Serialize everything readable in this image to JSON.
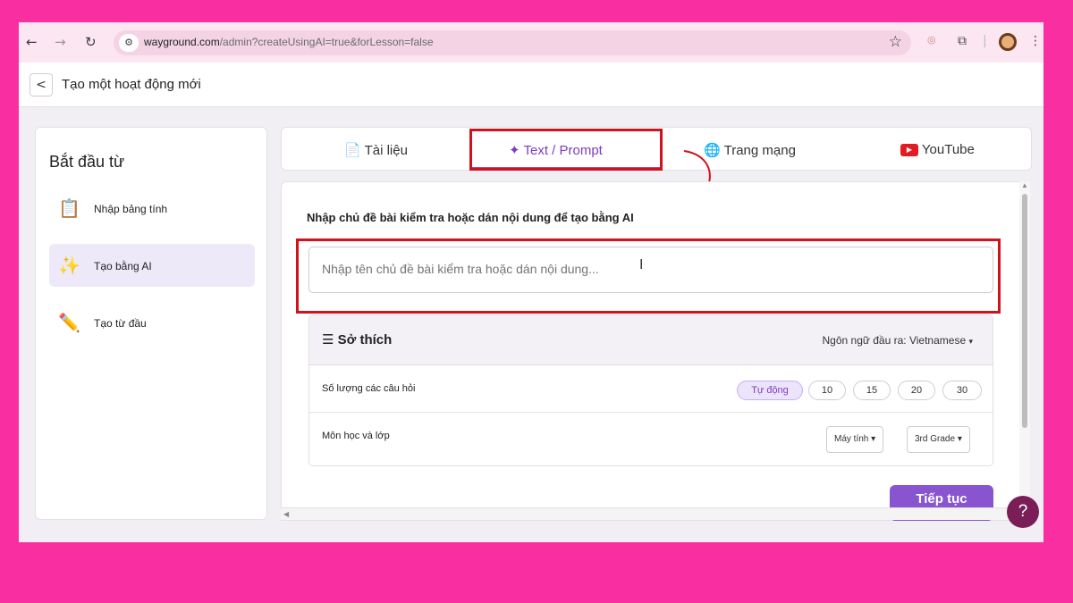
{
  "browser": {
    "url_host": "wayground.com",
    "url_path": "/admin?createUsingAI=true&forLesson=false"
  },
  "header": {
    "title": "Tạo một hoạt động mới"
  },
  "sidebar": {
    "heading": "Bắt đầu từ",
    "items": [
      {
        "label": "Nhập bảng tính",
        "icon": "clipboard-icon",
        "selected": false
      },
      {
        "label": "Tạo bằng AI",
        "icon": "sparkle-icon",
        "selected": true
      },
      {
        "label": "Tạo từ đầu",
        "icon": "pencil-icon",
        "selected": false
      }
    ]
  },
  "tabs": [
    {
      "label": "Tài liệu",
      "icon": "document-icon"
    },
    {
      "label": "Text / Prompt",
      "icon": "sparkle-icon",
      "active": true
    },
    {
      "label": "Trang mạng",
      "icon": "globe-icon"
    },
    {
      "label": "YouTube",
      "icon": "youtube-icon"
    }
  ],
  "main": {
    "label": "Nhập chủ đề bài kiểm tra hoặc dán nội dung để tạo bằng AI",
    "input_placeholder": "Nhập tên chủ đề bài kiểm tra hoặc dán nội dung...",
    "input_value": "",
    "preferences": {
      "title": "Sở thích",
      "language_label": "Ngôn ngữ đầu ra:",
      "language_value": "Vietnamese",
      "question_count_label": "Số lượng các câu hỏi",
      "question_count_options": [
        "Tự động",
        "10",
        "15",
        "20",
        "30"
      ],
      "question_count_selected": "Tự động",
      "subject_label": "Môn học và lớp",
      "subject_value": "Máy tính",
      "grade_value": "3rd Grade"
    },
    "next_label": "Tiếp tục"
  },
  "help_label": "?",
  "colors": {
    "background": "#f92fa1",
    "accent": "#8854d0",
    "highlight_border": "#d0121b"
  }
}
